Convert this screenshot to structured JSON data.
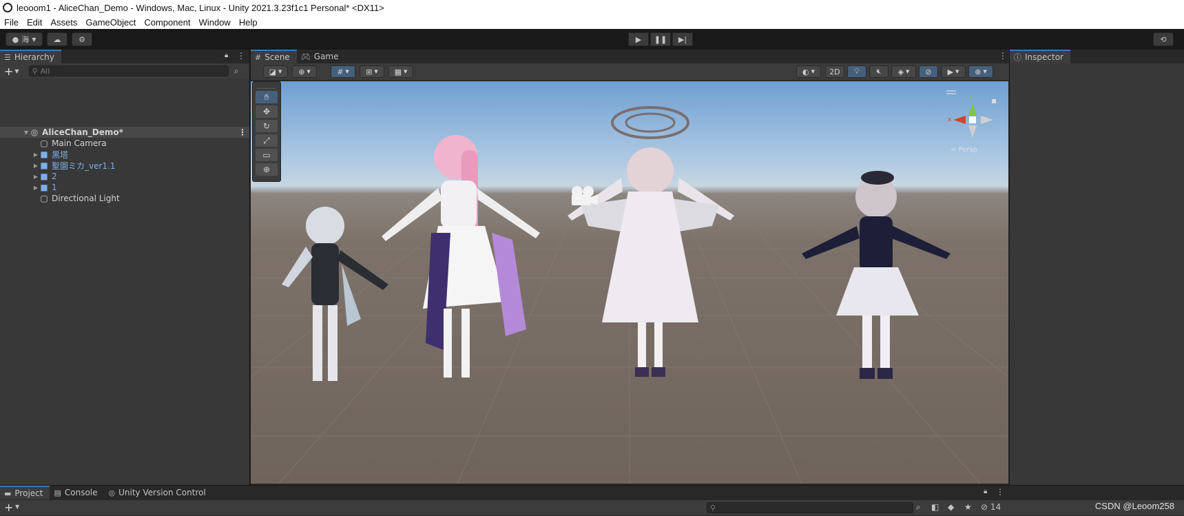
{
  "window": {
    "title": "leooom1 - AliceChan_Demo - Windows, Mac, Linux - Unity 2021.3.23f1c1 Personal* <DX11>"
  },
  "menu": [
    "File",
    "Edit",
    "Assets",
    "GameObject",
    "Component",
    "Window",
    "Help"
  ],
  "toolbar": {
    "account_label": "海",
    "play_icon": "play-icon",
    "pause_icon": "pause-icon",
    "step_icon": "step-icon"
  },
  "hierarchy": {
    "tab": "Hierarchy",
    "search_placeholder": "All",
    "scene_name": "AliceChan_Demo*",
    "items": [
      {
        "label": "Main Camera",
        "expandable": false,
        "prefab": false
      },
      {
        "label": "黒塔",
        "expandable": true,
        "prefab": true
      },
      {
        "label": "聖園ミカ_ver1.1",
        "expandable": true,
        "prefab": true
      },
      {
        "label": "2",
        "expandable": true,
        "prefab": true
      },
      {
        "label": "1",
        "expandable": true,
        "prefab": true
      },
      {
        "label": "Directional Light",
        "expandable": false,
        "prefab": false
      }
    ]
  },
  "scene_view": {
    "tabs": [
      {
        "label": "Scene",
        "icon": "grid-icon"
      },
      {
        "label": "Game",
        "icon": "gamepad-icon"
      }
    ],
    "toggle_2d": "2D",
    "gizmo_axes": {
      "x": "x",
      "y": "y"
    },
    "gizmo_persp": "< Persp"
  },
  "inspector": {
    "tab": "Inspector"
  },
  "bottom": {
    "tabs": [
      {
        "label": "Project",
        "icon": "folder-icon"
      },
      {
        "label": "Console",
        "icon": "console-icon"
      },
      {
        "label": "Unity Version Control",
        "icon": "version-control-icon"
      }
    ],
    "hidden_count": "14"
  },
  "watermark": "CSDN @Leoom258",
  "colors": {
    "accent": "#3a79bb",
    "prefab_text": "#7faee8",
    "panel": "#383838"
  }
}
